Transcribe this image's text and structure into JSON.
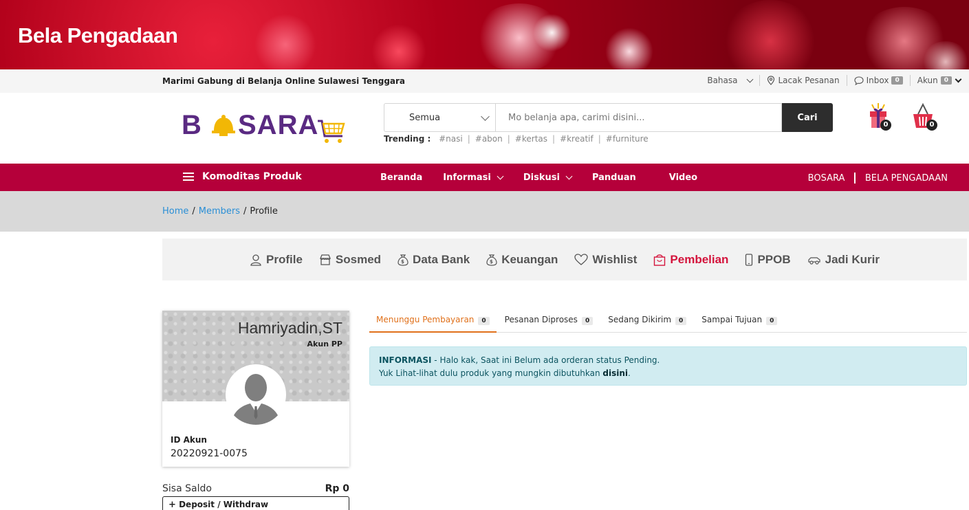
{
  "banner": {
    "title": "Bela Pengadaan"
  },
  "topbar": {
    "tagline": "Marimi Gabung di Belanja Online Sulawesi Tenggara",
    "language": "Bahasa",
    "track_order": "Lacak Pesanan",
    "inbox": "Inbox",
    "inbox_count": "0",
    "account": "Akun",
    "account_count": "0"
  },
  "logo": {
    "text_left": "B",
    "text_right": "SARA"
  },
  "search": {
    "category": "Semua",
    "placeholder": "Mo belanja apa, carimi disini...",
    "button": "Cari"
  },
  "trending": {
    "label": "Trending :",
    "tags": [
      "#nasi",
      "#abon",
      "#kertas",
      "#kreatif",
      "#furniture"
    ]
  },
  "header_icons": {
    "gift_count": "0",
    "cart_count": "0"
  },
  "nav": {
    "category_menu": "Komoditas Produk",
    "items": [
      "Beranda",
      "Informasi",
      "Diskusi",
      "Panduan",
      "Video"
    ],
    "right_links": [
      "BOSARA",
      "BELA PENGADAAN"
    ]
  },
  "breadcrumb": {
    "home": "Home",
    "members": "Members",
    "current": "Profile",
    "sep": "/"
  },
  "member_menu": {
    "items": [
      "Profile",
      "Sosmed",
      "Data Bank",
      "Keuangan",
      "Wishlist",
      "Pembelian",
      "PPOB",
      "Jadi Kurir"
    ],
    "active": "Pembelian"
  },
  "profile": {
    "name": "Hamriyadin,ST",
    "account_type": "Akun PP",
    "id_label": "ID Akun",
    "id_value": "20220921-0075",
    "balance_label": "Sisa Saldo",
    "balance_value": "Rp 0",
    "deposit_button": "Deposit / Withdraw"
  },
  "order_tabs": [
    {
      "label": "Menunggu Pembayaran",
      "count": "0"
    },
    {
      "label": "Pesanan Diproses",
      "count": "0"
    },
    {
      "label": "Sedang Dikirim",
      "count": "0"
    },
    {
      "label": "Sampai Tujuan",
      "count": "0"
    }
  ],
  "alert": {
    "title": "INFORMASI",
    "line1": " - Halo kak, Saat ini Belum ada orderan status Pending.",
    "line2": "Yuk Lihat-lihat dulu produk yang mungkin dibutuhkan ",
    "link": "disini",
    "end": "."
  },
  "colors": {
    "nav_bg": "#b5003a",
    "active_menu": "#d4143c",
    "active_tab": "#e0701a",
    "alert_bg": "#d1ecf1",
    "logo_purple": "#5a2a82",
    "logo_gold": "#f2b705"
  }
}
